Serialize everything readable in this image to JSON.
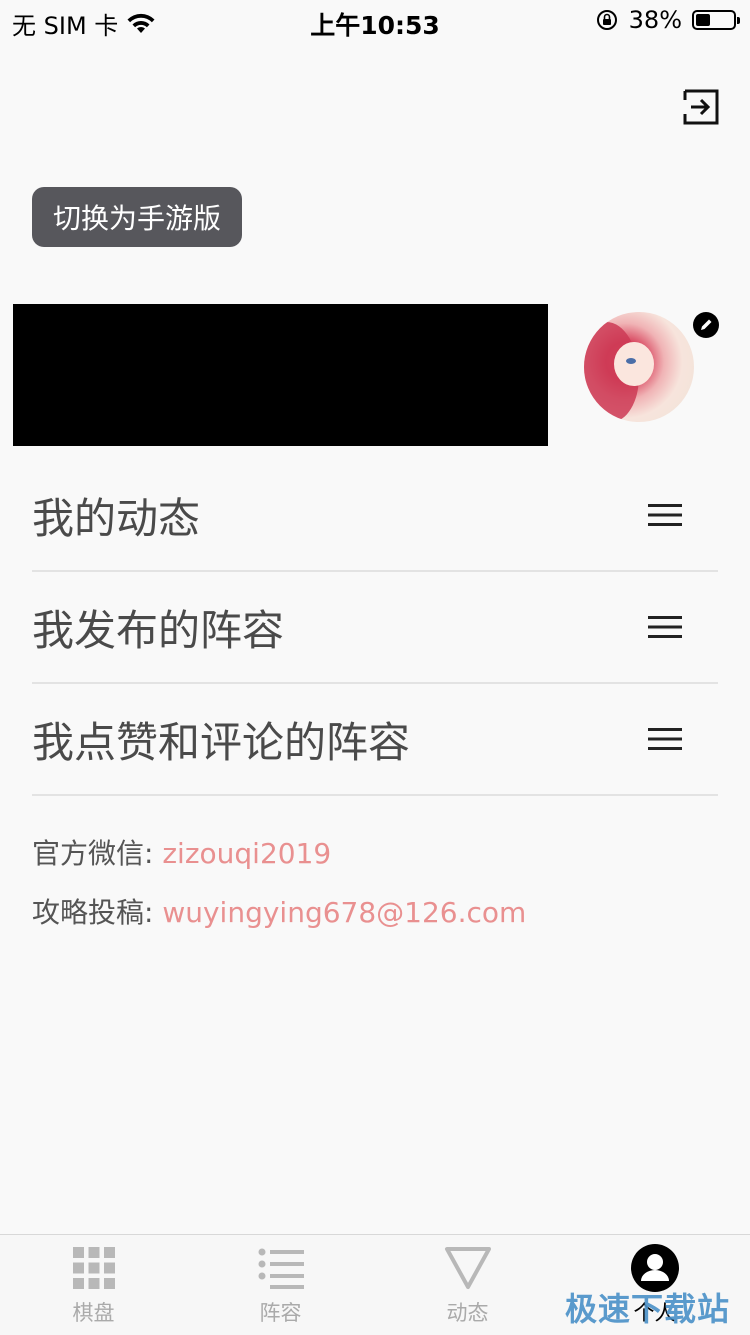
{
  "status_bar": {
    "carrier": "无 SIM 卡",
    "time": "上午10:53",
    "battery_percent": "38%",
    "battery_level": 0.38,
    "icons": [
      "wifi-icon",
      "rotation-lock-icon",
      "battery-icon"
    ]
  },
  "header": {
    "exit_icon": "exit-icon",
    "switch_button_label": "切换为手游版"
  },
  "profile": {
    "avatar_alt": "avatar",
    "edit_icon": "edit-icon"
  },
  "menu": {
    "items": [
      {
        "label": "我的动态",
        "icon": "hamburger-icon"
      },
      {
        "label": "我发布的阵容",
        "icon": "hamburger-icon"
      },
      {
        "label": "我点赞和评论的阵容",
        "icon": "hamburger-icon"
      }
    ]
  },
  "contacts": {
    "wechat_label": "官方微信: ",
    "wechat_value": "zizouqi2019",
    "submit_label": "攻略投稿: ",
    "submit_value": "wuyingying678@126.com"
  },
  "tabbar": {
    "tabs": [
      {
        "label": "棋盘",
        "icon": "grid-icon",
        "active": false
      },
      {
        "label": "阵容",
        "icon": "list-icon",
        "active": false
      },
      {
        "label": "动态",
        "icon": "triangle-icon",
        "active": false
      },
      {
        "label": "个人",
        "icon": "user-icon",
        "active": true
      }
    ]
  },
  "watermark": "极速下载站",
  "colors": {
    "accent_link": "#e99090",
    "switch_button_bg": "#57575c",
    "background": "#f9f9f9"
  }
}
